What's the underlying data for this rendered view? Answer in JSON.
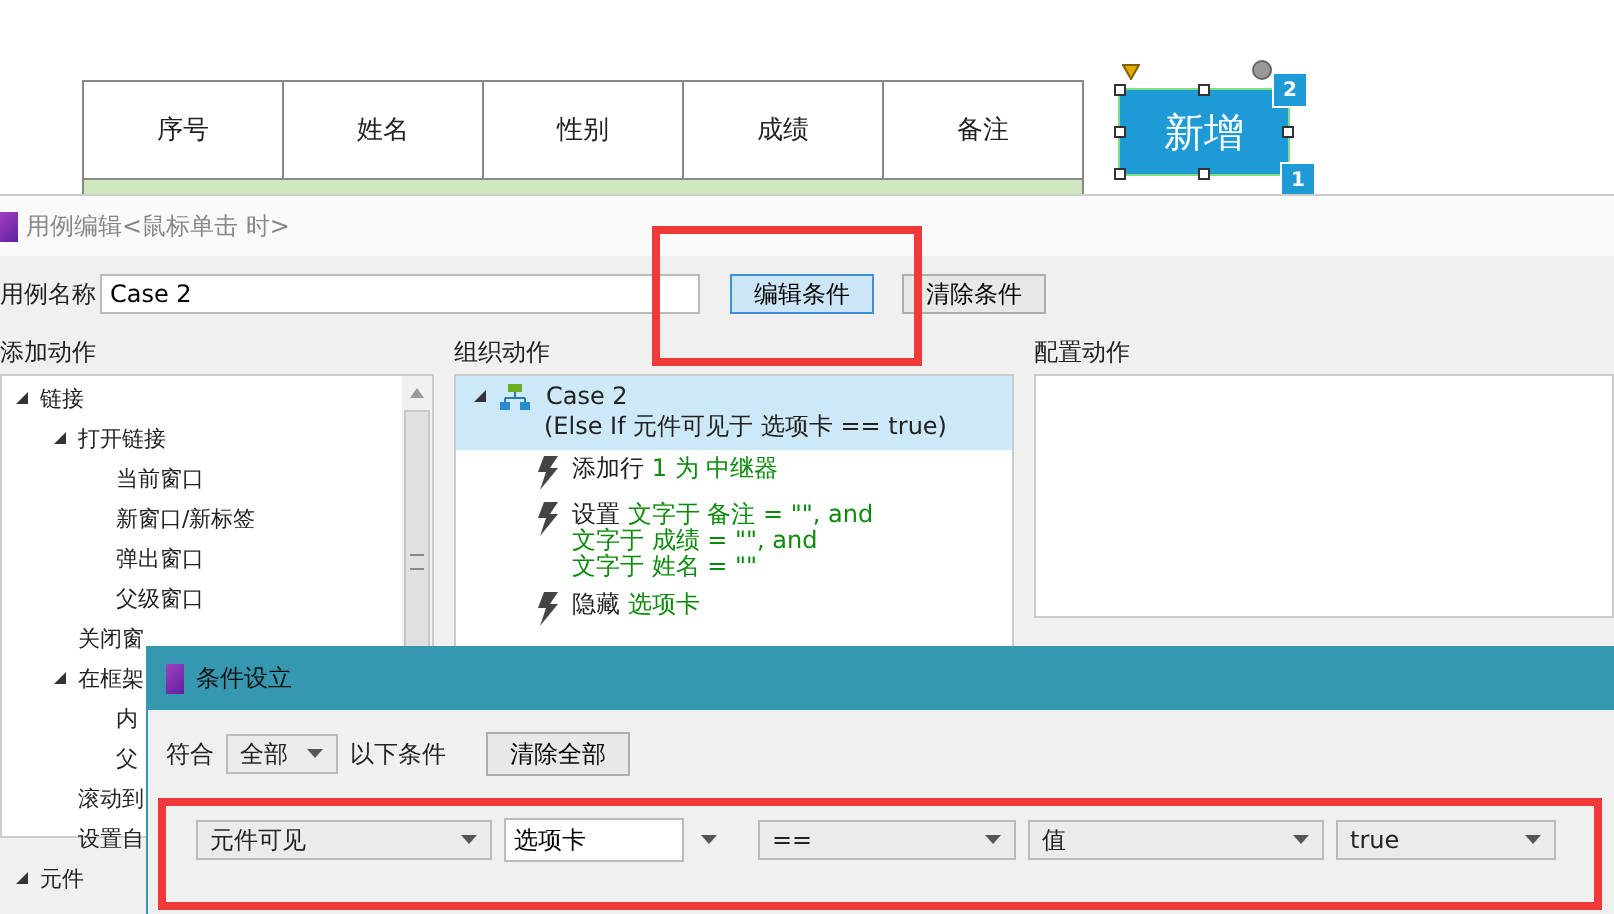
{
  "canvas": {
    "table": {
      "columns": [
        "序号",
        "姓名",
        "性别",
        "成绩",
        "备注"
      ]
    },
    "button": {
      "label": "新增",
      "selected": true
    },
    "badges": [
      "2",
      "1"
    ]
  },
  "case_editor": {
    "title": "用例编辑<鼠标单击 时>",
    "name_label": "用例名称",
    "name_value": "Case 2",
    "buttons": [
      {
        "label": "编辑条件",
        "focused": true
      },
      {
        "label": "清除条件",
        "focused": false
      }
    ],
    "sections": [
      "添加动作",
      "组织动作",
      "配置动作"
    ],
    "actions_tree": [
      {
        "label": "链接",
        "expanded": true,
        "children": [
          {
            "label": "打开链接",
            "expanded": true,
            "children": [
              {
                "label": "当前窗口"
              },
              {
                "label": "新窗口/新标签"
              },
              {
                "label": "弹出窗口"
              },
              {
                "label": "父级窗口"
              }
            ]
          },
          {
            "label": "关闭窗"
          },
          {
            "label": "在框架",
            "expanded": true,
            "children": [
              {
                "label": "内"
              },
              {
                "label": "父"
              }
            ]
          },
          {
            "label": "滚动到"
          },
          {
            "label": "设置自"
          }
        ]
      },
      {
        "label": "元件",
        "expanded": true
      }
    ],
    "case": {
      "title": "Case 2",
      "condition": "(Else If 元件可见于 选项卡 == true)",
      "selected": true,
      "expanded": true,
      "actions": [
        {
          "lines": [
            [
              {
                "text": "添加行",
                "kind": "verb"
              },
              {
                "text": "1 为 中继器",
                "kind": "value"
              }
            ]
          ]
        },
        {
          "lines": [
            [
              {
                "text": "设置",
                "kind": "verb"
              },
              {
                "text": "文字于 备注 = \"\", and",
                "kind": "value"
              }
            ],
            [
              {
                "text": "文字于 成绩 = \"\", and",
                "kind": "value"
              }
            ],
            [
              {
                "text": "文字于 姓名 = \"\"",
                "kind": "value"
              }
            ]
          ]
        },
        {
          "lines": [
            [
              {
                "text": "隐藏",
                "kind": "verb"
              },
              {
                "text": "选项卡",
                "kind": "value"
              }
            ]
          ]
        }
      ]
    }
  },
  "condition_dialog": {
    "title": "条件设立",
    "match_label": "符合",
    "match_value": "全部",
    "after_label": "以下条件",
    "clear_button": "清除全部",
    "condition": [
      {
        "kind": "dropdown",
        "value": "元件可见"
      },
      {
        "kind": "combo",
        "value": "选项卡"
      },
      {
        "kind": "dropdown",
        "value": "=="
      },
      {
        "kind": "dropdown",
        "value": "值"
      },
      {
        "kind": "dropdown",
        "value": "true"
      }
    ]
  }
}
